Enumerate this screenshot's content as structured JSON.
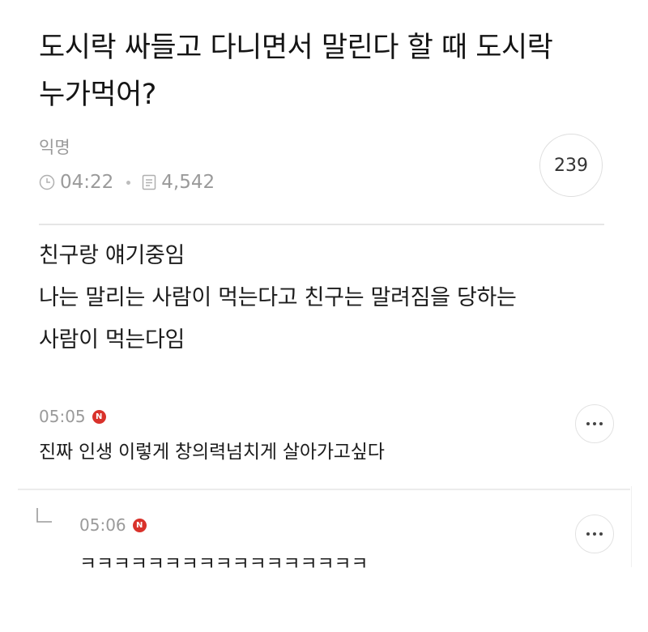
{
  "post": {
    "title_lines": [
      "도시락 싸들고 다니면서 말린다 할 때 도시락",
      "누가먹어?"
    ],
    "author": "익명",
    "time": "04:22",
    "views": "4,542",
    "comment_count": "239",
    "body_lines": [
      "친구랑 얘기중임",
      "나는 말리는 사람이 먹는다고 친구는 말려짐을 당하는",
      "사람이 먹는다임"
    ]
  },
  "comments": [
    {
      "time": "05:05",
      "badge": "N",
      "text": "진짜 인생 이렇게 창의력넘치게 살아가고싶다"
    },
    {
      "time": "05:06",
      "badge": "N",
      "text": "ㅋㅋㅋㅋㅋㅋㅋㅋㅋㅋㅋㅋㅋㅋㅋㅋㅋ",
      "is_reply": true
    }
  ],
  "icons": {
    "time": "clock-icon",
    "views": "document-icon",
    "more": "more-options-icon",
    "reply": "reply-arrow-icon",
    "new": "new-badge-icon"
  },
  "colors": {
    "new_badge": "#d9322b",
    "meta_text": "#9a9a9a"
  }
}
